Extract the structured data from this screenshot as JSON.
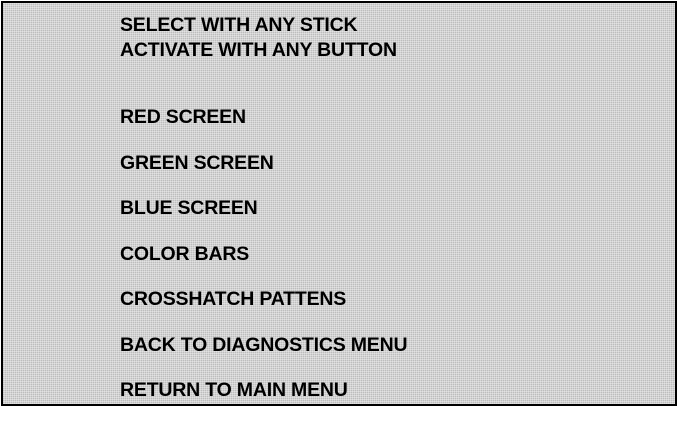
{
  "instructions": {
    "line1": "SELECT WITH ANY STICK",
    "line2": "ACTIVATE WITH ANY BUTTON"
  },
  "menu": {
    "items": [
      {
        "label": "RED SCREEN"
      },
      {
        "label": "GREEN SCREEN"
      },
      {
        "label": "BLUE SCREEN"
      },
      {
        "label": "COLOR BARS"
      },
      {
        "label": "CROSSHATCH PATTENS"
      },
      {
        "label": "BACK TO DIAGNOSTICS MENU"
      },
      {
        "label": "RETURN TO MAIN MENU"
      }
    ]
  },
  "colors": {
    "background": "#d2d2d2",
    "text": "#000000",
    "border": "#000000"
  }
}
